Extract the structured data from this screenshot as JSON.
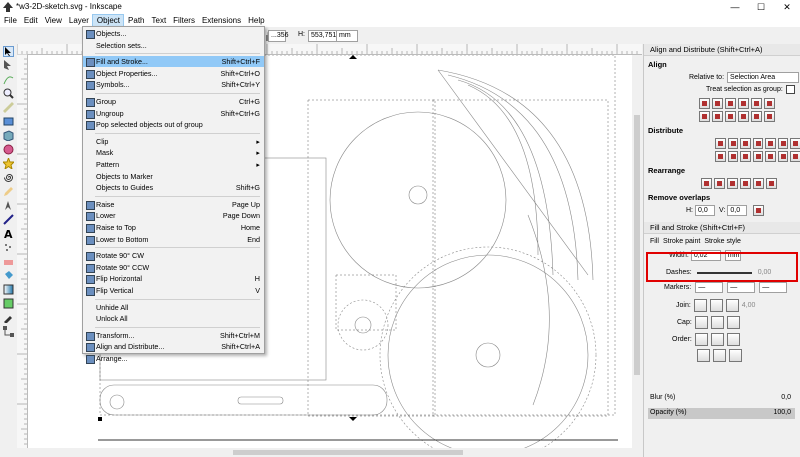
{
  "window": {
    "title": "*w3-2D-sketch.svg - Inkscape",
    "min": "—",
    "max": "☐",
    "close": "✕"
  },
  "menubar": [
    {
      "label": "File"
    },
    {
      "label": "Edit"
    },
    {
      "label": "View"
    },
    {
      "label": "Layer"
    },
    {
      "label": "Object",
      "active": true
    },
    {
      "label": "Path"
    },
    {
      "label": "Text"
    },
    {
      "label": "Filters"
    },
    {
      "label": "Extensions"
    },
    {
      "label": "Help"
    }
  ],
  "toolbar": {
    "w_value": "...356",
    "h_label": "H:",
    "h_value": "553,751",
    "unit": "mm"
  },
  "object_menu": {
    "items": [
      {
        "label": "Objects...",
        "shortcut": "",
        "icon": "objects-icon"
      },
      {
        "label": "Selection sets...",
        "shortcut": "",
        "icon": ""
      },
      {
        "label": "Fill and Stroke...",
        "shortcut": "Shift+Ctrl+F",
        "icon": "fill-stroke-icon",
        "highlighted": true
      },
      {
        "label": "Object Properties...",
        "shortcut": "Shift+Ctrl+O",
        "icon": "properties-icon"
      },
      {
        "label": "Symbols...",
        "shortcut": "Shift+Ctrl+Y",
        "icon": "symbols-icon"
      },
      {
        "label": "Group",
        "shortcut": "Ctrl+G",
        "icon": "group-icon"
      },
      {
        "label": "Ungroup",
        "shortcut": "Shift+Ctrl+G",
        "icon": "ungroup-icon"
      },
      {
        "label": "Pop selected objects out of group",
        "shortcut": "",
        "icon": "pop-group-icon"
      },
      {
        "label": "Clip",
        "shortcut": "▸",
        "icon": ""
      },
      {
        "label": "Mask",
        "shortcut": "▸",
        "icon": ""
      },
      {
        "label": "Pattern",
        "shortcut": "▸",
        "icon": ""
      },
      {
        "label": "Objects to Marker",
        "shortcut": "",
        "icon": ""
      },
      {
        "label": "Objects to Guides",
        "shortcut": "Shift+G",
        "icon": ""
      },
      {
        "label": "Raise",
        "shortcut": "Page Up",
        "icon": "raise-icon"
      },
      {
        "label": "Lower",
        "shortcut": "Page Down",
        "icon": "lower-icon"
      },
      {
        "label": "Raise to Top",
        "shortcut": "Home",
        "icon": "raise-top-icon"
      },
      {
        "label": "Lower to Bottom",
        "shortcut": "End",
        "icon": "lower-bottom-icon"
      },
      {
        "label": "Rotate 90° CW",
        "shortcut": "",
        "icon": "rotate-cw-icon"
      },
      {
        "label": "Rotate 90° CCW",
        "shortcut": "",
        "icon": "rotate-ccw-icon"
      },
      {
        "label": "Flip Horizontal",
        "shortcut": "H",
        "icon": "flip-h-icon"
      },
      {
        "label": "Flip Vertical",
        "shortcut": "V",
        "icon": "flip-v-icon"
      },
      {
        "label": "Unhide All",
        "shortcut": "",
        "icon": ""
      },
      {
        "label": "Unlock All",
        "shortcut": "",
        "icon": ""
      },
      {
        "label": "Transform...",
        "shortcut": "Shift+Ctrl+M",
        "icon": "transform-icon"
      },
      {
        "label": "Align and Distribute...",
        "shortcut": "Shift+Ctrl+A",
        "icon": "align-icon"
      },
      {
        "label": "Arrange...",
        "shortcut": "",
        "icon": "arrange-icon"
      }
    ]
  },
  "align_panel": {
    "header": "Align and Distribute (Shift+Ctrl+A)",
    "align_title": "Align",
    "relative_label": "Relative to:",
    "relative_value": "Selection Area",
    "treat_group": "Treat selection as group:",
    "distribute_title": "Distribute",
    "rearrange_title": "Rearrange",
    "remove_overlaps_title": "Remove overlaps",
    "h_label": "H:",
    "h_value": "0,0",
    "v_label": "V:",
    "v_value": "0,0"
  },
  "fill_stroke": {
    "header": "Fill and Stroke (Shift+Ctrl+F)",
    "tab_fill": "Fill",
    "tab_stroke_paint": "Stroke paint",
    "tab_stroke_style": "Stroke style",
    "width_label": "Width:",
    "width_value": "0,02",
    "width_unit": "mm",
    "dashes_label": "Dashes:",
    "dashes_value": "0,00",
    "markers_label": "Markers:",
    "join_label": "Join:",
    "join_value": "4,00",
    "cap_label": "Cap:",
    "order_label": "Order:",
    "blur_label": "Blur (%)",
    "blur_value": "0,0",
    "opacity_label": "Opacity (%)",
    "opacity_value": "100,0"
  },
  "colors": {
    "highlight": "#91c9f7",
    "red_box": "#e00000"
  }
}
